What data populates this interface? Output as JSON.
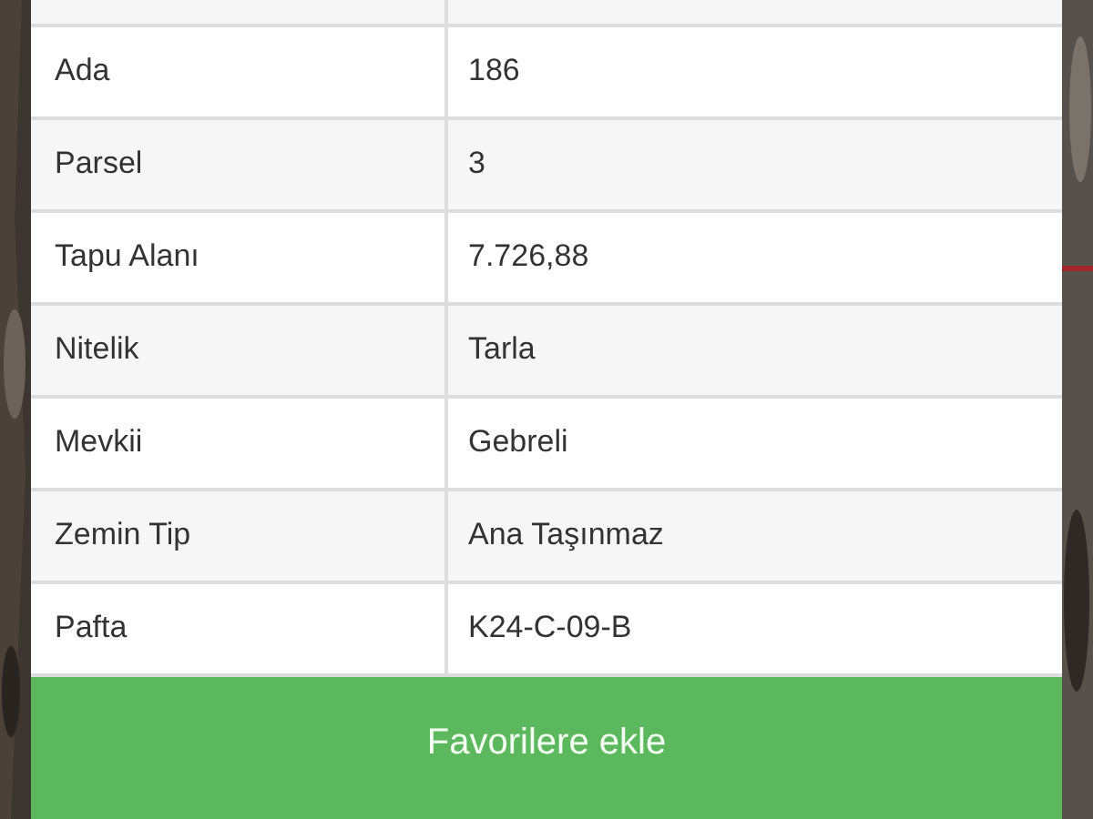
{
  "rows": [
    {
      "label": "Ada",
      "value": "186"
    },
    {
      "label": "Parsel",
      "value": "3"
    },
    {
      "label": "Tapu Alanı",
      "value": "7.726,88"
    },
    {
      "label": "Nitelik",
      "value": "Tarla"
    },
    {
      "label": "Mevkii",
      "value": "Gebreli"
    },
    {
      "label": "Zemin Tip",
      "value": "Ana Taşınmaz"
    },
    {
      "label": "Pafta",
      "value": "K24-C-09-B"
    }
  ],
  "button": {
    "label": "Favorilere ekle"
  }
}
